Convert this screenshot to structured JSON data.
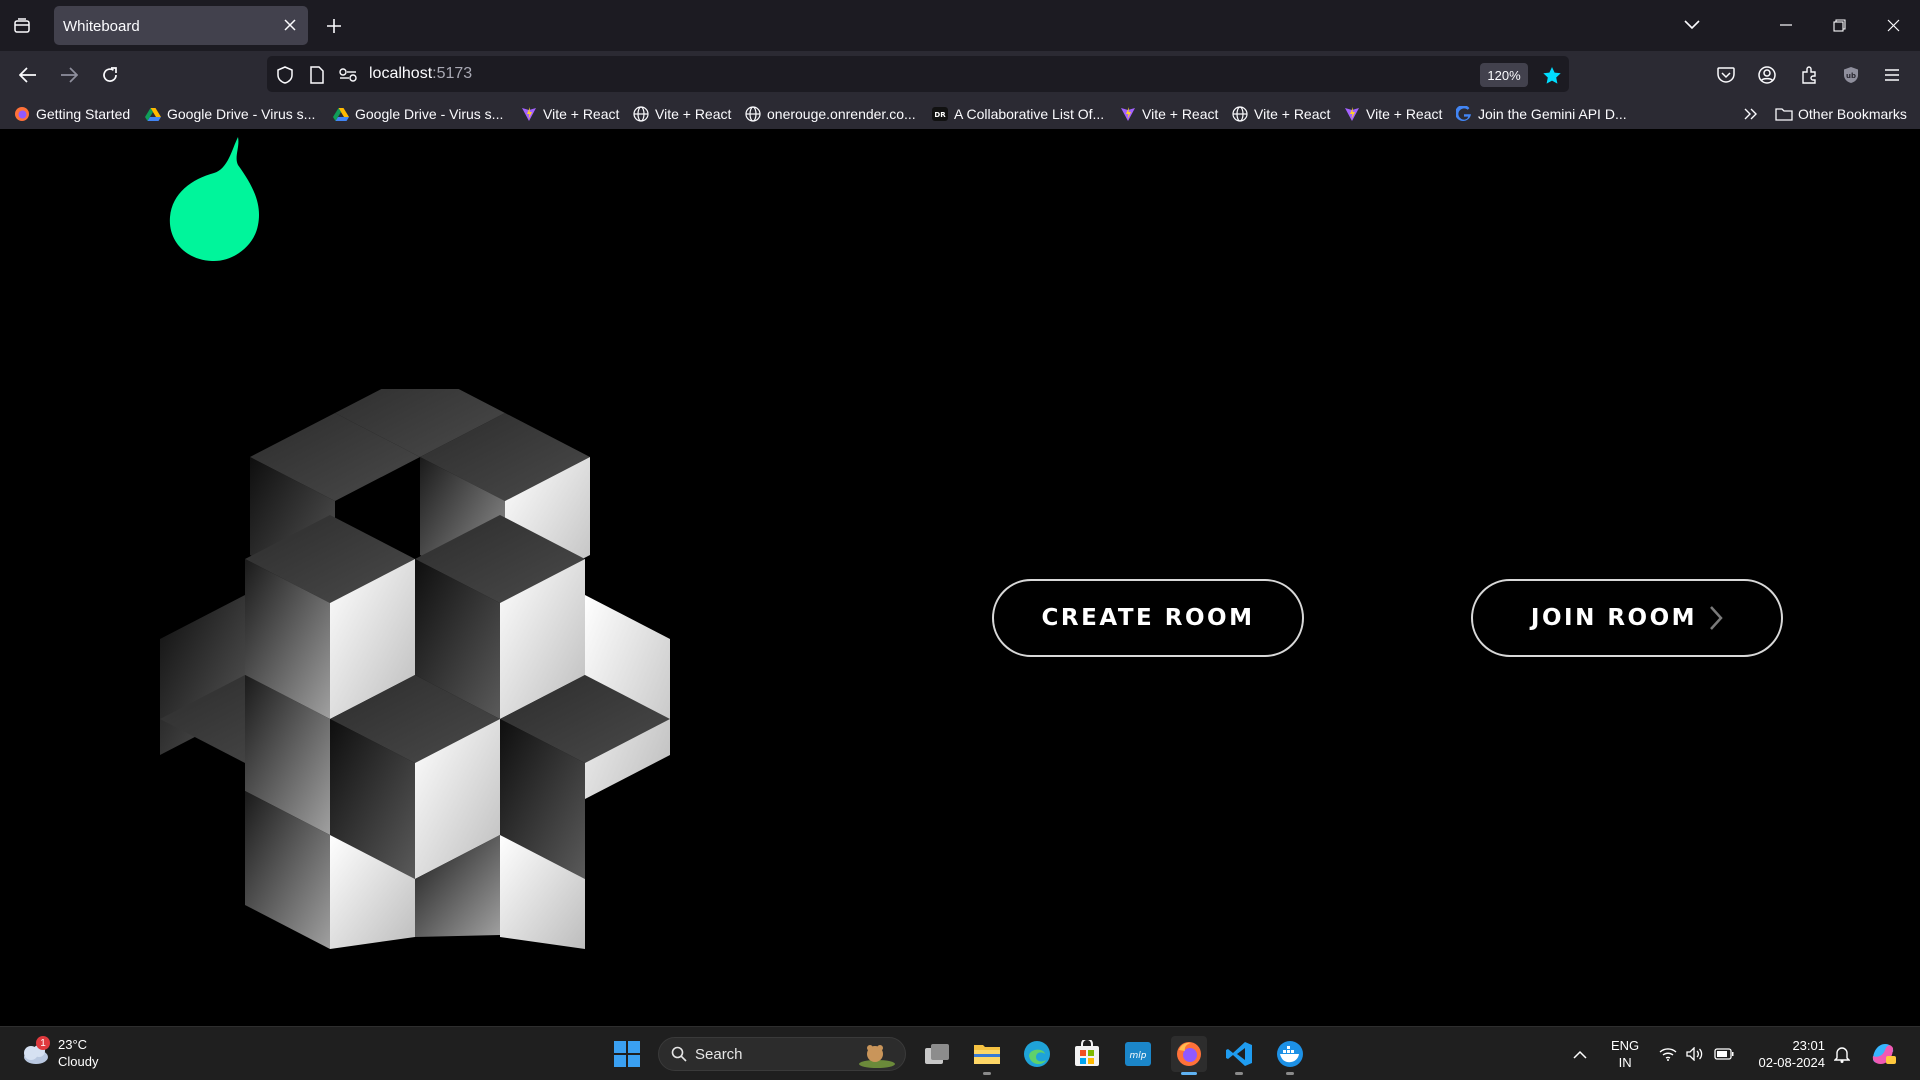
{
  "browser": {
    "tab": {
      "title": "Whiteboard"
    },
    "url": {
      "host": "localhost",
      "port": ":5173"
    },
    "zoom": "120%",
    "bookmarks": [
      {
        "label": "Getting Started",
        "icon": "firefox-icon"
      },
      {
        "label": "Google Drive - Virus s...",
        "icon": "google-drive-icon"
      },
      {
        "label": "Google Drive - Virus s...",
        "icon": "google-drive-icon"
      },
      {
        "label": "Vite + React",
        "icon": "vite-icon"
      },
      {
        "label": "Vite + React",
        "icon": "globe-icon"
      },
      {
        "label": "onerouge.onrender.co...",
        "icon": "globe-icon"
      },
      {
        "label": "A Collaborative List Of...",
        "icon": "dr-icon"
      },
      {
        "label": "Vite + React",
        "icon": "vite-icon"
      },
      {
        "label": "Vite + React",
        "icon": "globe-icon"
      },
      {
        "label": "Vite + React",
        "icon": "vite-icon"
      },
      {
        "label": "Join the Gemini API D...",
        "icon": "google-icon"
      }
    ],
    "other_bookmarks": "Other Bookmarks"
  },
  "page": {
    "create_room_label": "CREATE ROOM",
    "join_room_label": "JOIN ROOM",
    "accent_color": "#00f59b"
  },
  "taskbar": {
    "weather": {
      "temp": "23°C",
      "condition": "Cloudy",
      "badge": "1"
    },
    "search_label": "Search",
    "lang": {
      "line1": "ENG",
      "line2": "IN"
    },
    "clock": {
      "time": "23:01",
      "date": "02-08-2024"
    }
  }
}
